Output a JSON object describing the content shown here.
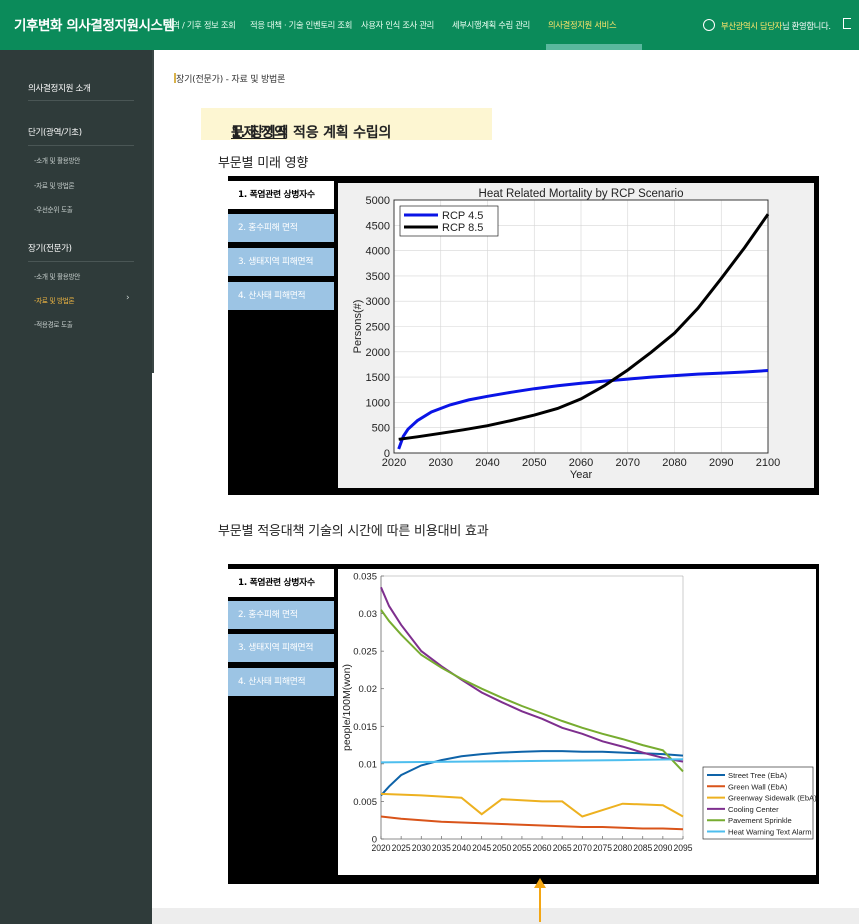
{
  "app_title": "기후변화 의사결정지원시스템",
  "nav": [
    {
      "label": "지역 / 기후 정보 조회"
    },
    {
      "label": "적응 대책 · 기술 인벤토리 조회"
    },
    {
      "label": "사용자 인식 조사 관리"
    },
    {
      "label": "세부시행계획 수립 관리"
    },
    {
      "label": "의사결정지원 서비스"
    }
  ],
  "user": {
    "name": "부산광역시 담당자",
    "suffix": "님 환영합니다."
  },
  "sidebar": {
    "intro": "의사결정지원 소개",
    "short_term": {
      "title": "단기(광역/기초)",
      "items": [
        "-소개 및 활용방안",
        "-자료 및 방법론",
        "-우선순위 도출"
      ]
    },
    "long_term": {
      "title": "장기(전문가)",
      "items": [
        "-소개 및 활용방안",
        "-자료 및 방법론",
        "-적용경로 도출"
      ]
    }
  },
  "breadcrumb": "장기(전문가) - 자료 및 방법론",
  "heading1": {
    "prefix": "1. 장기적 적응 계획 수립의 ",
    "underlined": "문제 정의"
  },
  "section1_title": "부문별 미래 영향",
  "section2_title": "부문별 적응대책 기술의 시간에 따른 비용대비 효과",
  "tabs": [
    "1. 폭염관련 상병자수",
    "2. 홍수피해 면적",
    "3. 생태지역 피해면적",
    "4. 산사태 피해면적"
  ],
  "colors": {
    "topbar": "#0b8b5a",
    "sidebar": "#2f3b3a",
    "accent": "#f4b942"
  },
  "chart_data": [
    {
      "type": "line",
      "title": "Heat Related Mortality by RCP Scenario",
      "xlabel": "Year",
      "ylabel": "Persons(#)",
      "xlim": [
        2020,
        2100
      ],
      "ylim": [
        0,
        5000
      ],
      "xticks": [
        2020,
        2030,
        2040,
        2050,
        2060,
        2070,
        2080,
        2090,
        2100
      ],
      "yticks": [
        0,
        500,
        1000,
        1500,
        2000,
        2500,
        3000,
        3500,
        4000,
        4500,
        5000
      ],
      "legend": "top-left",
      "grid": true,
      "series": [
        {
          "name": "RCP 4.5",
          "color": "#0a14e6",
          "x": [
            2021,
            2022,
            2023,
            2025,
            2028,
            2032,
            2036,
            2040,
            2045,
            2050,
            2055,
            2060,
            2065,
            2070,
            2075,
            2080,
            2085,
            2090,
            2095,
            2100
          ],
          "y": [
            80,
            330,
            470,
            640,
            810,
            950,
            1050,
            1120,
            1200,
            1270,
            1330,
            1380,
            1420,
            1460,
            1500,
            1530,
            1560,
            1580,
            1600,
            1630
          ]
        },
        {
          "name": "RCP 8.5",
          "color": "#000000",
          "x": [
            2021,
            2025,
            2030,
            2035,
            2040,
            2045,
            2050,
            2055,
            2060,
            2065,
            2070,
            2075,
            2080,
            2085,
            2090,
            2095,
            2100
          ],
          "y": [
            270,
            320,
            390,
            460,
            540,
            640,
            750,
            880,
            1070,
            1330,
            1640,
            1990,
            2370,
            2860,
            3450,
            4060,
            4720
          ]
        }
      ]
    },
    {
      "type": "line",
      "title": "",
      "xlabel": "",
      "ylabel": "people/100M(won)",
      "xlim": [
        2020,
        2095
      ],
      "ylim": [
        0,
        0.035
      ],
      "xticks": [
        2020,
        2025,
        2030,
        2035,
        2040,
        2045,
        2050,
        2055,
        2060,
        2065,
        2070,
        2075,
        2080,
        2085,
        2090,
        2095
      ],
      "yticks": [
        0,
        0.005,
        0.01,
        0.015,
        0.02,
        0.025,
        0.03,
        0.035
      ],
      "ytick_labels": [
        "0",
        "0.005",
        "0.01",
        "0.015",
        "0.02",
        "0.025",
        "0.03",
        "0.035"
      ],
      "legend": "bottom-right",
      "grid": false,
      "series": [
        {
          "name": "Street Tree (EbA)",
          "color": "#0e63a8",
          "x": [
            2020,
            2022,
            2025,
            2030,
            2035,
            2040,
            2045,
            2050,
            2055,
            2060,
            2065,
            2070,
            2075,
            2080,
            2085,
            2090,
            2095
          ],
          "y": [
            0.0058,
            0.007,
            0.0085,
            0.0098,
            0.0105,
            0.011,
            0.0113,
            0.0115,
            0.0116,
            0.0117,
            0.0117,
            0.0116,
            0.0116,
            0.0115,
            0.0114,
            0.0113,
            0.0111
          ]
        },
        {
          "name": "Green Wall (EbA)",
          "color": "#d9541a",
          "x": [
            2020,
            2025,
            2030,
            2035,
            2040,
            2045,
            2050,
            2055,
            2060,
            2065,
            2070,
            2075,
            2080,
            2085,
            2090,
            2095
          ],
          "y": [
            0.003,
            0.0027,
            0.0025,
            0.0023,
            0.0022,
            0.0021,
            0.002,
            0.0019,
            0.0018,
            0.0017,
            0.0016,
            0.0016,
            0.0015,
            0.0014,
            0.0014,
            0.0013
          ]
        },
        {
          "name": "Greenway Sidewalk (EbA)",
          "color": "#edb120",
          "x": [
            2020,
            2030,
            2040,
            2045,
            2050,
            2060,
            2065,
            2070,
            2080,
            2090,
            2095
          ],
          "y": [
            0.006,
            0.0058,
            0.0055,
            0.0033,
            0.0053,
            0.005,
            0.005,
            0.003,
            0.0047,
            0.0045,
            0.003
          ]
        },
        {
          "name": "Cooling Center",
          "color": "#7e2f8e",
          "x": [
            2020,
            2022,
            2025,
            2030,
            2035,
            2040,
            2045,
            2050,
            2055,
            2060,
            2065,
            2070,
            2075,
            2080,
            2085,
            2090,
            2095
          ],
          "y": [
            0.0335,
            0.031,
            0.0285,
            0.025,
            0.023,
            0.0212,
            0.0195,
            0.0182,
            0.017,
            0.016,
            0.0148,
            0.014,
            0.013,
            0.0123,
            0.0115,
            0.0108,
            0.0103
          ]
        },
        {
          "name": "Pavement Sprinkle",
          "color": "#77ac30",
          "x": [
            2020,
            2022,
            2025,
            2030,
            2035,
            2040,
            2045,
            2050,
            2055,
            2060,
            2065,
            2070,
            2075,
            2080,
            2085,
            2090,
            2095
          ],
          "y": [
            0.0305,
            0.029,
            0.0272,
            0.0245,
            0.0228,
            0.0213,
            0.02,
            0.0188,
            0.0177,
            0.0167,
            0.0157,
            0.0148,
            0.014,
            0.0133,
            0.0125,
            0.0118,
            0.009
          ]
        },
        {
          "name": "Heat Warning Text Alarm",
          "color": "#4dbeee",
          "x": [
            2020,
            2040,
            2060,
            2080,
            2095
          ],
          "y": [
            0.0102,
            0.0103,
            0.0104,
            0.0105,
            0.0106
          ]
        }
      ]
    }
  ]
}
